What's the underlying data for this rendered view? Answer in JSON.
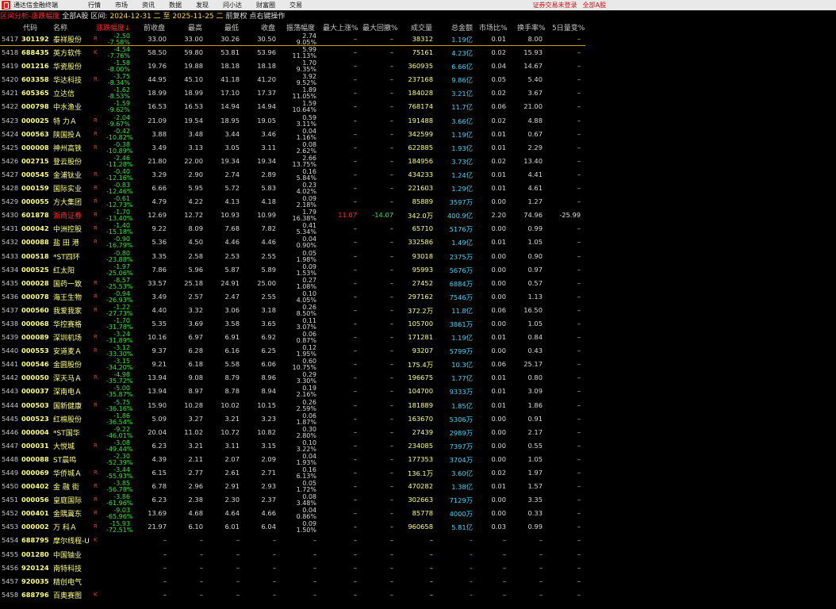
{
  "menubar": {
    "app_title": "通达信金融终端",
    "items": [
      "行情",
      "市场",
      "资讯",
      "数据",
      "发现",
      "问小达",
      "财富圈",
      "交易"
    ],
    "login": "证券交易未登录",
    "market": "全部A股"
  },
  "titlebar": {
    "part1": "区间分析-涨跌幅度",
    "part2": "全部A股",
    "part3": "区间:",
    "date_range": "2024-12-31 二 至 2025-11-25 二",
    "part4": "前复权 点右键操作"
  },
  "columns": {
    "code": "代码",
    "name": "名称",
    "chg": "涨跌幅度↓",
    "prev": "前收盘",
    "high": "最高",
    "low": "最低",
    "close": "收盘",
    "amp": "振荡幅度",
    "rise": "最大上涨%",
    "draw": "最大回撤%",
    "vol": "成交量",
    "amt": "总金额",
    "mkt": "市场比%",
    "turn": "换手率%",
    "vr": "5日量变%"
  },
  "colors": {
    "down": "#3ee03e",
    "up": "#ff3030",
    "code": "#ffff80",
    "amount": "#46d4ff",
    "background": "#000000"
  },
  "rows": [
    {
      "seq": "5417",
      "code": "301192",
      "name": "泰祥股份",
      "flag": "R",
      "ch": "-2.50",
      "pct": "-7.58%",
      "prev": "33.00",
      "high": "33.00",
      "low": "30.26",
      "close": "30.50",
      "a1": "2.74",
      "a2": "9.05%",
      "rise": "–",
      "draw": "–",
      "vol": "38312",
      "amt": "1.19亿",
      "mkt": "0.01",
      "turn": "8.00",
      "vr": "–"
    },
    {
      "seq": "5418",
      "code": "688435",
      "name": "英方软件",
      "flag": "K",
      "ch": "-4.54",
      "pct": "-7.76%",
      "prev": "58.50",
      "high": "59.80",
      "low": "53.81",
      "close": "53.96",
      "a1": "5.99",
      "a2": "11.13%",
      "rise": "–",
      "draw": "–",
      "vol": "75161",
      "amt": "4.23亿",
      "mkt": "0.02",
      "turn": "15.93",
      "vr": "–"
    },
    {
      "seq": "5419",
      "code": "001216",
      "name": "华瓷股份",
      "flag": "",
      "ch": "-1.58",
      "pct": "-8.00%",
      "prev": "19.76",
      "high": "19.88",
      "low": "18.18",
      "close": "18.18",
      "a1": "1.70",
      "a2": "9.35%",
      "rise": "–",
      "draw": "–",
      "vol": "360935",
      "amt": "6.66亿",
      "mkt": "0.04",
      "turn": "14.67",
      "vr": "–"
    },
    {
      "seq": "5420",
      "code": "603358",
      "name": "华达科技",
      "flag": "R",
      "ch": "-3.75",
      "pct": "-8.34%",
      "prev": "44.95",
      "high": "45.10",
      "low": "41.18",
      "close": "41.20",
      "a1": "3.92",
      "a2": "9.52%",
      "rise": "–",
      "draw": "–",
      "vol": "237168",
      "amt": "9.86亿",
      "mkt": "0.05",
      "turn": "5.40",
      "vr": "–"
    },
    {
      "seq": "5421",
      "code": "605365",
      "name": "立达信",
      "flag": "",
      "ch": "-1.62",
      "pct": "-8.53%",
      "prev": "18.99",
      "high": "18.99",
      "low": "17.10",
      "close": "17.37",
      "a1": "1.89",
      "a2": "11.05%",
      "rise": "–",
      "draw": "–",
      "vol": "184028",
      "amt": "3.21亿",
      "mkt": "0.02",
      "turn": "3.67",
      "vr": "–"
    },
    {
      "seq": "5422",
      "code": "000798",
      "name": "中水渔业",
      "flag": "",
      "ch": "-1.59",
      "pct": "-9.62%",
      "prev": "16.53",
      "high": "16.53",
      "low": "14.94",
      "close": "14.94",
      "a1": "1.59",
      "a2": "10.64%",
      "rise": "–",
      "draw": "–",
      "vol": "768174",
      "amt": "11.7亿",
      "mkt": "0.06",
      "turn": "21.00",
      "vr": "–"
    },
    {
      "seq": "5423",
      "code": "000025",
      "name": "特 力Ａ",
      "flag": "R",
      "ch": "-2.04",
      "pct": "-9.67%",
      "prev": "21.09",
      "high": "19.54",
      "low": "18.95",
      "close": "19.05",
      "a1": "0.59",
      "a2": "3.11%",
      "rise": "–",
      "draw": "–",
      "vol": "191488",
      "amt": "3.66亿",
      "mkt": "0.02",
      "turn": "4.88",
      "vr": "–"
    },
    {
      "seq": "5424",
      "code": "000563",
      "name": "陕国投Ａ",
      "flag": "R",
      "ch": "-0.42",
      "pct": "-10.82%",
      "prev": "3.88",
      "high": "3.48",
      "low": "3.44",
      "close": "3.46",
      "a1": "0.04",
      "a2": "1.16%",
      "rise": "–",
      "draw": "–",
      "vol": "342599",
      "amt": "1.19亿",
      "mkt": "0.01",
      "turn": "0.67",
      "vr": "–"
    },
    {
      "seq": "5425",
      "code": "000008",
      "name": "神州高铁",
      "flag": "R",
      "ch": "-0.38",
      "pct": "-10.89%",
      "prev": "3.49",
      "high": "3.13",
      "low": "3.05",
      "close": "3.11",
      "a1": "0.08",
      "a2": "2.62%",
      "rise": "–",
      "draw": "–",
      "vol": "622885",
      "amt": "1.93亿",
      "mkt": "0.01",
      "turn": "2.29",
      "vr": "–"
    },
    {
      "seq": "5426",
      "code": "002715",
      "name": "登云股份",
      "flag": "",
      "ch": "-2.46",
      "pct": "-11.28%",
      "prev": "21.80",
      "high": "22.00",
      "low": "19.34",
      "close": "19.34",
      "a1": "2.66",
      "a2": "13.75%",
      "rise": "–",
      "draw": "–",
      "vol": "184956",
      "amt": "3.73亿",
      "mkt": "0.02",
      "turn": "13.40",
      "vr": "–"
    },
    {
      "seq": "5427",
      "code": "000545",
      "name": "金浦钛业",
      "flag": "R",
      "ch": "-0.40",
      "pct": "-12.16%",
      "prev": "3.29",
      "high": "2.90",
      "low": "2.74",
      "close": "2.89",
      "a1": "0.16",
      "a2": "5.84%",
      "rise": "–",
      "draw": "–",
      "vol": "434233",
      "amt": "1.24亿",
      "mkt": "0.01",
      "turn": "4.41",
      "vr": "–"
    },
    {
      "seq": "5428",
      "code": "000159",
      "name": "国际实业",
      "flag": "R",
      "ch": "-0.83",
      "pct": "-12.46%",
      "prev": "6.66",
      "high": "5.95",
      "low": "5.72",
      "close": "5.83",
      "a1": "0.23",
      "a2": "4.02%",
      "rise": "–",
      "draw": "–",
      "vol": "221603",
      "amt": "1.29亿",
      "mkt": "0.01",
      "turn": "4.61",
      "vr": "–"
    },
    {
      "seq": "5429",
      "code": "000055",
      "name": "方大集团",
      "flag": "R",
      "ch": "-0.61",
      "pct": "-12.73%",
      "prev": "4.79",
      "high": "4.22",
      "low": "4.13",
      "close": "4.18",
      "a1": "0.09",
      "a2": "2.18%",
      "rise": "–",
      "draw": "–",
      "vol": "85889",
      "amt": "3597万",
      "mkt": "0.00",
      "turn": "1.27",
      "vr": "–"
    },
    {
      "seq": "5430",
      "code": "601878",
      "name": "浙商证券",
      "flag": "R",
      "ch": "-1.70",
      "pct": "-13.40%",
      "prev": "12.69",
      "high": "12.72",
      "low": "10.93",
      "close": "10.99",
      "a1": "1.79",
      "a2": "16.38%",
      "rise": "11.07",
      "draw": "-14.07",
      "vol": "342.0万",
      "amt": "400.9亿",
      "mkt": "2.20",
      "turn": "74.96",
      "vr": "-25.99",
      "sel": true
    },
    {
      "seq": "5431",
      "code": "000042",
      "name": "中洲控股",
      "flag": "R",
      "ch": "-1.40",
      "pct": "-15.18%",
      "prev": "9.22",
      "high": "8.09",
      "low": "7.68",
      "close": "7.82",
      "a1": "0.41",
      "a2": "5.34%",
      "rise": "–",
      "draw": "–",
      "vol": "65710",
      "amt": "5176万",
      "mkt": "0.00",
      "turn": "0.99",
      "vr": "–"
    },
    {
      "seq": "5432",
      "code": "000088",
      "name": "盐 田 港",
      "flag": "R",
      "ch": "-0.90",
      "pct": "-16.79%",
      "prev": "5.36",
      "high": "4.50",
      "low": "4.46",
      "close": "4.46",
      "a1": "0.04",
      "a2": "0.90%",
      "rise": "–",
      "draw": "–",
      "vol": "332586",
      "amt": "1.49亿",
      "mkt": "0.01",
      "turn": "1.05",
      "vr": "–"
    },
    {
      "seq": "5433",
      "code": "000518",
      "name": "*ST四环",
      "flag": "",
      "ch": "-0.80",
      "pct": "-23.88%",
      "prev": "3.35",
      "high": "2.58",
      "low": "2.53",
      "close": "2.55",
      "a1": "0.05",
      "a2": "1.98%",
      "rise": "–",
      "draw": "–",
      "vol": "93018",
      "amt": "2375万",
      "mkt": "0.00",
      "turn": "0.90",
      "vr": "–"
    },
    {
      "seq": "5434",
      "code": "000525",
      "name": "红太阳",
      "flag": "",
      "ch": "-1.97",
      "pct": "-25.06%",
      "prev": "7.86",
      "high": "5.96",
      "low": "5.87",
      "close": "5.89",
      "a1": "0.09",
      "a2": "1.53%",
      "rise": "–",
      "draw": "–",
      "vol": "95993",
      "amt": "5676万",
      "mkt": "0.00",
      "turn": "0.97",
      "vr": "–"
    },
    {
      "seq": "5435",
      "code": "000028",
      "name": "国药一致",
      "flag": "R",
      "ch": "-8.57",
      "pct": "-25.53%",
      "prev": "33.57",
      "high": "25.18",
      "low": "24.91",
      "close": "25.00",
      "a1": "0.27",
      "a2": "1.08%",
      "rise": "–",
      "draw": "–",
      "vol": "27452",
      "amt": "6884万",
      "mkt": "0.00",
      "turn": "0.57",
      "vr": "–"
    },
    {
      "seq": "5436",
      "code": "000078",
      "name": "海王生物",
      "flag": "R",
      "ch": "-0.94",
      "pct": "-26.93%",
      "prev": "3.49",
      "high": "2.57",
      "low": "2.47",
      "close": "2.55",
      "a1": "0.10",
      "a2": "4.05%",
      "rise": "–",
      "draw": "–",
      "vol": "297162",
      "amt": "7546万",
      "mkt": "0.00",
      "turn": "1.13",
      "vr": "–"
    },
    {
      "seq": "5437",
      "code": "000560",
      "name": "我爱我家",
      "flag": "R",
      "ch": "-1.22",
      "pct": "-27.73%",
      "prev": "4.40",
      "high": "3.32",
      "low": "3.06",
      "close": "3.18",
      "a1": "0.26",
      "a2": "8.50%",
      "rise": "–",
      "draw": "–",
      "vol": "372.2万",
      "amt": "11.8亿",
      "mkt": "0.06",
      "turn": "16.50",
      "vr": "–"
    },
    {
      "seq": "5438",
      "code": "000068",
      "name": "华控赛格",
      "flag": "",
      "ch": "-1.70",
      "pct": "-31.78%",
      "prev": "5.35",
      "high": "3.69",
      "low": "3.58",
      "close": "3.65",
      "a1": "0.11",
      "a2": "3.07%",
      "rise": "–",
      "draw": "–",
      "vol": "105700",
      "amt": "3861万",
      "mkt": "0.00",
      "turn": "1.05",
      "vr": "–"
    },
    {
      "seq": "5439",
      "code": "000089",
      "name": "深圳机场",
      "flag": "R",
      "ch": "-3.24",
      "pct": "-31.89%",
      "prev": "10.16",
      "high": "6.97",
      "low": "6.91",
      "close": "6.92",
      "a1": "0.06",
      "a2": "0.87%",
      "rise": "–",
      "draw": "–",
      "vol": "171281",
      "amt": "1.19亿",
      "mkt": "0.01",
      "turn": "0.84",
      "vr": "–"
    },
    {
      "seq": "5440",
      "code": "000553",
      "name": "安道麦Ａ",
      "flag": "R",
      "ch": "-3.12",
      "pct": "-33.30%",
      "prev": "9.37",
      "high": "6.28",
      "low": "6.16",
      "close": "6.25",
      "a1": "0.12",
      "a2": "1.95%",
      "rise": "–",
      "draw": "–",
      "vol": "93207",
      "amt": "5799万",
      "mkt": "0.00",
      "turn": "0.43",
      "vr": "–"
    },
    {
      "seq": "5441",
      "code": "000546",
      "name": "金圆股份",
      "flag": "",
      "ch": "-3.15",
      "pct": "-34.20%",
      "prev": "9.21",
      "high": "6.18",
      "low": "5.58",
      "close": "6.06",
      "a1": "0.60",
      "a2": "10.75%",
      "rise": "–",
      "draw": "–",
      "vol": "175.4万",
      "amt": "10.3亿",
      "mkt": "0.06",
      "turn": "25.17",
      "vr": "–"
    },
    {
      "seq": "5442",
      "code": "000050",
      "name": "深天马Ａ",
      "flag": "R",
      "ch": "-4.98",
      "pct": "-35.72%",
      "prev": "13.94",
      "high": "9.08",
      "low": "8.79",
      "close": "8.96",
      "a1": "0.29",
      "a2": "3.30%",
      "rise": "–",
      "draw": "–",
      "vol": "196675",
      "amt": "1.77亿",
      "mkt": "0.01",
      "turn": "0.80",
      "vr": "–"
    },
    {
      "seq": "5443",
      "code": "000037",
      "name": "深南电Ａ",
      "flag": "",
      "ch": "-5.00",
      "pct": "-35.87%",
      "prev": "13.94",
      "high": "8.97",
      "low": "8.78",
      "close": "8.94",
      "a1": "0.19",
      "a2": "2.16%",
      "rise": "–",
      "draw": "–",
      "vol": "104700",
      "amt": "9333万",
      "mkt": "0.01",
      "turn": "3.09",
      "vr": "–"
    },
    {
      "seq": "5444",
      "code": "000503",
      "name": "国新健康",
      "flag": "R",
      "ch": "-5.75",
      "pct": "-36.16%",
      "prev": "15.90",
      "high": "10.28",
      "low": "10.02",
      "close": "10.15",
      "a1": "0.26",
      "a2": "2.59%",
      "rise": "–",
      "draw": "–",
      "vol": "181889",
      "amt": "1.85亿",
      "mkt": "0.01",
      "turn": "1.86",
      "vr": "–"
    },
    {
      "seq": "5445",
      "code": "000523",
      "name": "红棉股份",
      "flag": "",
      "ch": "-1.86",
      "pct": "-36.54%",
      "prev": "5.09",
      "high": "3.27",
      "low": "3.21",
      "close": "3.23",
      "a1": "0.06",
      "a2": "1.87%",
      "rise": "–",
      "draw": "–",
      "vol": "163670",
      "amt": "5306万",
      "mkt": "0.00",
      "turn": "0.91",
      "vr": "–"
    },
    {
      "seq": "5446",
      "code": "000004",
      "name": "*ST国华",
      "flag": "",
      "ch": "-9.22",
      "pct": "-46.01%",
      "prev": "20.04",
      "high": "11.02",
      "low": "10.72",
      "close": "10.82",
      "a1": "0.30",
      "a2": "2.80%",
      "rise": "–",
      "draw": "–",
      "vol": "27439",
      "amt": "2989万",
      "mkt": "0.00",
      "turn": "2.17",
      "vr": "–"
    },
    {
      "seq": "5447",
      "code": "000031",
      "name": "大悦城",
      "flag": "R",
      "ch": "-3.08",
      "pct": "-49.44%",
      "prev": "6.23",
      "high": "3.21",
      "low": "3.11",
      "close": "3.15",
      "a1": "0.10",
      "a2": "3.22%",
      "rise": "–",
      "draw": "–",
      "vol": "234085",
      "amt": "7397万",
      "mkt": "0.00",
      "turn": "0.55",
      "vr": "–"
    },
    {
      "seq": "5448",
      "code": "000088",
      "name": "ST晨鸣",
      "flag": "",
      "ch": "-2.30",
      "pct": "-52.39%",
      "prev": "4.39",
      "high": "2.11",
      "low": "2.07",
      "close": "2.09",
      "a1": "0.04",
      "a2": "1.93%",
      "rise": "–",
      "draw": "–",
      "vol": "177353",
      "amt": "3704万",
      "mkt": "0.00",
      "turn": "1.05",
      "vr": "–"
    },
    {
      "seq": "5449",
      "code": "000069",
      "name": "华侨城Ａ",
      "flag": "R",
      "ch": "-3.44",
      "pct": "-55.93%",
      "prev": "6.15",
      "high": "2.77",
      "low": "2.61",
      "close": "2.71",
      "a1": "0.16",
      "a2": "6.13%",
      "rise": "–",
      "draw": "–",
      "vol": "136.1万",
      "amt": "3.60亿",
      "mkt": "0.02",
      "turn": "1.97",
      "vr": "–"
    },
    {
      "seq": "5450",
      "code": "000402",
      "name": "金 融 街",
      "flag": "R",
      "ch": "-3.85",
      "pct": "-56.78%",
      "prev": "6.78",
      "high": "2.96",
      "low": "2.91",
      "close": "2.93",
      "a1": "0.05",
      "a2": "1.72%",
      "rise": "–",
      "draw": "–",
      "vol": "470282",
      "amt": "1.38亿",
      "mkt": "0.01",
      "turn": "1.57",
      "vr": "–"
    },
    {
      "seq": "5451",
      "code": "000056",
      "name": "皇庭国际",
      "flag": "R",
      "ch": "-3.86",
      "pct": "-61.96%",
      "prev": "6.23",
      "high": "2.38",
      "low": "2.30",
      "close": "2.37",
      "a1": "0.08",
      "a2": "3.48%",
      "rise": "–",
      "draw": "–",
      "vol": "302663",
      "amt": "7129万",
      "mkt": "0.00",
      "turn": "3.35",
      "vr": "–"
    },
    {
      "seq": "5452",
      "code": "000401",
      "name": "金隅冀东",
      "flag": "R",
      "ch": "-9.03",
      "pct": "-65.96%",
      "prev": "13.69",
      "high": "4.68",
      "low": "4.64",
      "close": "4.66",
      "a1": "0.04",
      "a2": "0.86%",
      "rise": "–",
      "draw": "–",
      "vol": "85778",
      "amt": "4000万",
      "mkt": "0.00",
      "turn": "0.33",
      "vr": "–"
    },
    {
      "seq": "5453",
      "code": "000002",
      "name": "万 科Ａ",
      "flag": "R",
      "ch": "-15.93",
      "pct": "-72.51%",
      "prev": "21.97",
      "high": "6.10",
      "low": "6.01",
      "close": "6.04",
      "a1": "0.09",
      "a2": "1.50%",
      "rise": "–",
      "draw": "–",
      "vol": "960658",
      "amt": "5.81亿",
      "mkt": "0.03",
      "turn": "0.99",
      "vr": "–"
    },
    {
      "seq": "5454",
      "code": "688795",
      "name": "摩尔线程-U",
      "flag": "K",
      "ch": "",
      "pct": "",
      "prev": "–",
      "high": "–",
      "low": "–",
      "close": "–",
      "a1": "–",
      "a2": "",
      "rise": "–",
      "draw": "–",
      "vol": "–",
      "amt": "–",
      "mkt": "–",
      "turn": "–",
      "vr": "–"
    },
    {
      "seq": "5455",
      "code": "001280",
      "name": "中国铀业",
      "flag": "",
      "ch": "",
      "pct": "",
      "prev": "–",
      "high": "–",
      "low": "–",
      "close": "–",
      "a1": "–",
      "a2": "",
      "rise": "–",
      "draw": "–",
      "vol": "–",
      "amt": "–",
      "mkt": "–",
      "turn": "–",
      "vr": "–"
    },
    {
      "seq": "5456",
      "code": "920124",
      "name": "南特科技",
      "flag": "",
      "ch": "",
      "pct": "",
      "prev": "–",
      "high": "–",
      "low": "–",
      "close": "–",
      "a1": "–",
      "a2": "",
      "rise": "–",
      "draw": "–",
      "vol": "–",
      "amt": "–",
      "mkt": "–",
      "turn": "–",
      "vr": "–"
    },
    {
      "seq": "5457",
      "code": "920035",
      "name": "精创电气",
      "flag": "",
      "ch": "",
      "pct": "",
      "prev": "–",
      "high": "–",
      "low": "–",
      "close": "–",
      "a1": "–",
      "a2": "",
      "rise": "–",
      "draw": "–",
      "vol": "–",
      "amt": "–",
      "mkt": "–",
      "turn": "–",
      "vr": "–"
    },
    {
      "seq": "5458",
      "code": "688796",
      "name": "百奥赛图",
      "flag": "K",
      "ch": "",
      "pct": "",
      "prev": "–",
      "high": "–",
      "low": "–",
      "close": "–",
      "a1": "–",
      "a2": "",
      "rise": "–",
      "draw": "–",
      "vol": "–",
      "amt": "–",
      "mkt": "–",
      "turn": "–",
      "vr": "–"
    }
  ]
}
